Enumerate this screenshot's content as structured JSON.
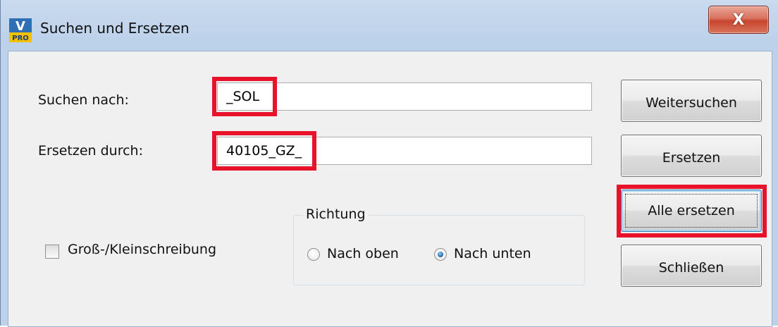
{
  "window": {
    "title": "Suchen und Ersetzen",
    "close_label": "X",
    "icon_text_top": "V",
    "icon_text_bottom": "PRO"
  },
  "form": {
    "search_label": "Suchen nach:",
    "search_value": "_SOL",
    "replace_label": "Ersetzen durch:",
    "replace_value": "40105_GZ_",
    "case_label": "Groß-/Kleinschreibung",
    "case_checked": false
  },
  "direction": {
    "legend": "Richtung",
    "up_label": "Nach oben",
    "down_label": "Nach unten",
    "selected": "down"
  },
  "buttons": {
    "find_next": "Weitersuchen",
    "replace": "Ersetzen",
    "replace_all": "Alle ersetzen",
    "close": "Schließen"
  },
  "colors": {
    "highlight": "#e8122a",
    "title_bg": "#bcd1ea",
    "dialog_bg": "#f0f0f0",
    "close_button": "#c8452e"
  }
}
